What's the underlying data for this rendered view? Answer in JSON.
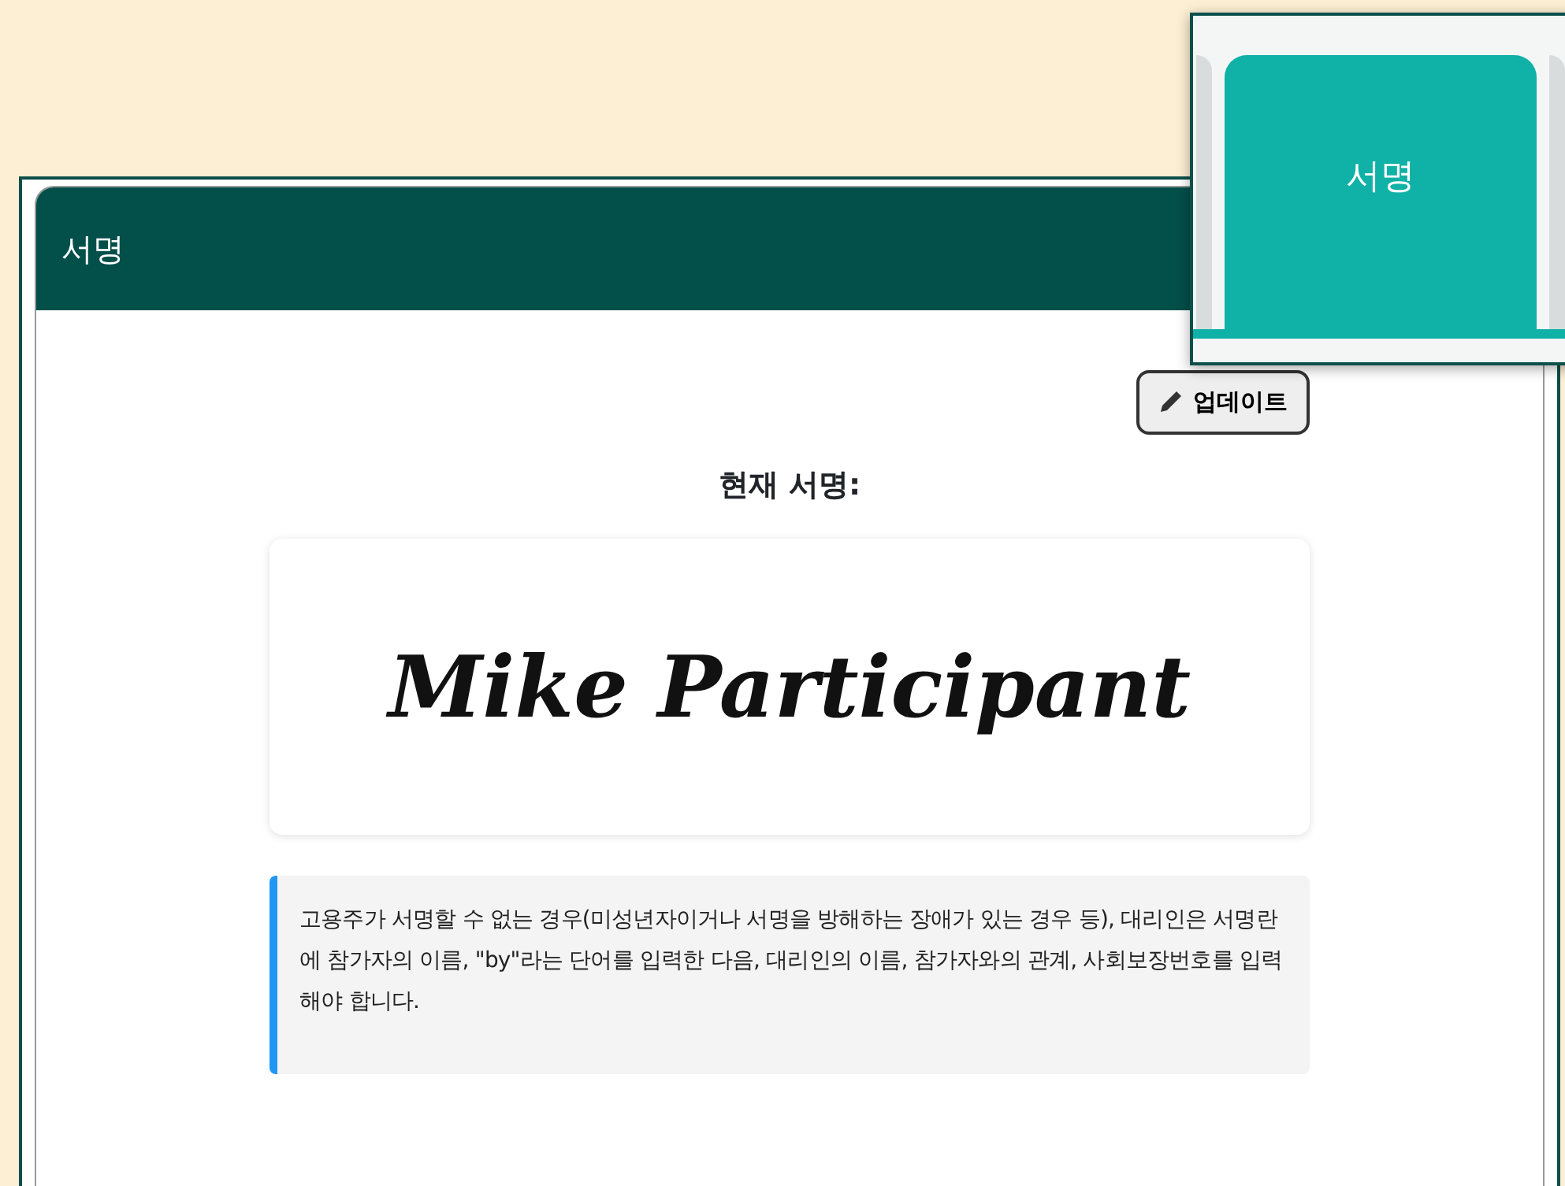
{
  "panel": {
    "title": "서명"
  },
  "update_button": {
    "label": "업데이트"
  },
  "current_signature": {
    "label": "현재 서명:",
    "signature": "Mike Participant"
  },
  "note": "고용주가 서명할 수 없는 경우(미성년자이거나 서명을 방해하는 장애가 있는 경우 등), 대리인은 서명란에 참가자의 이름, \"by\"라는 단어를 입력한 다음, 대리인의 이름, 참가자와의 관계, 사회보장번호를 입력해야 합니다.",
  "zoom_inset": {
    "tabs": [
      {
        "label": "서명",
        "selected": true
      }
    ]
  }
}
